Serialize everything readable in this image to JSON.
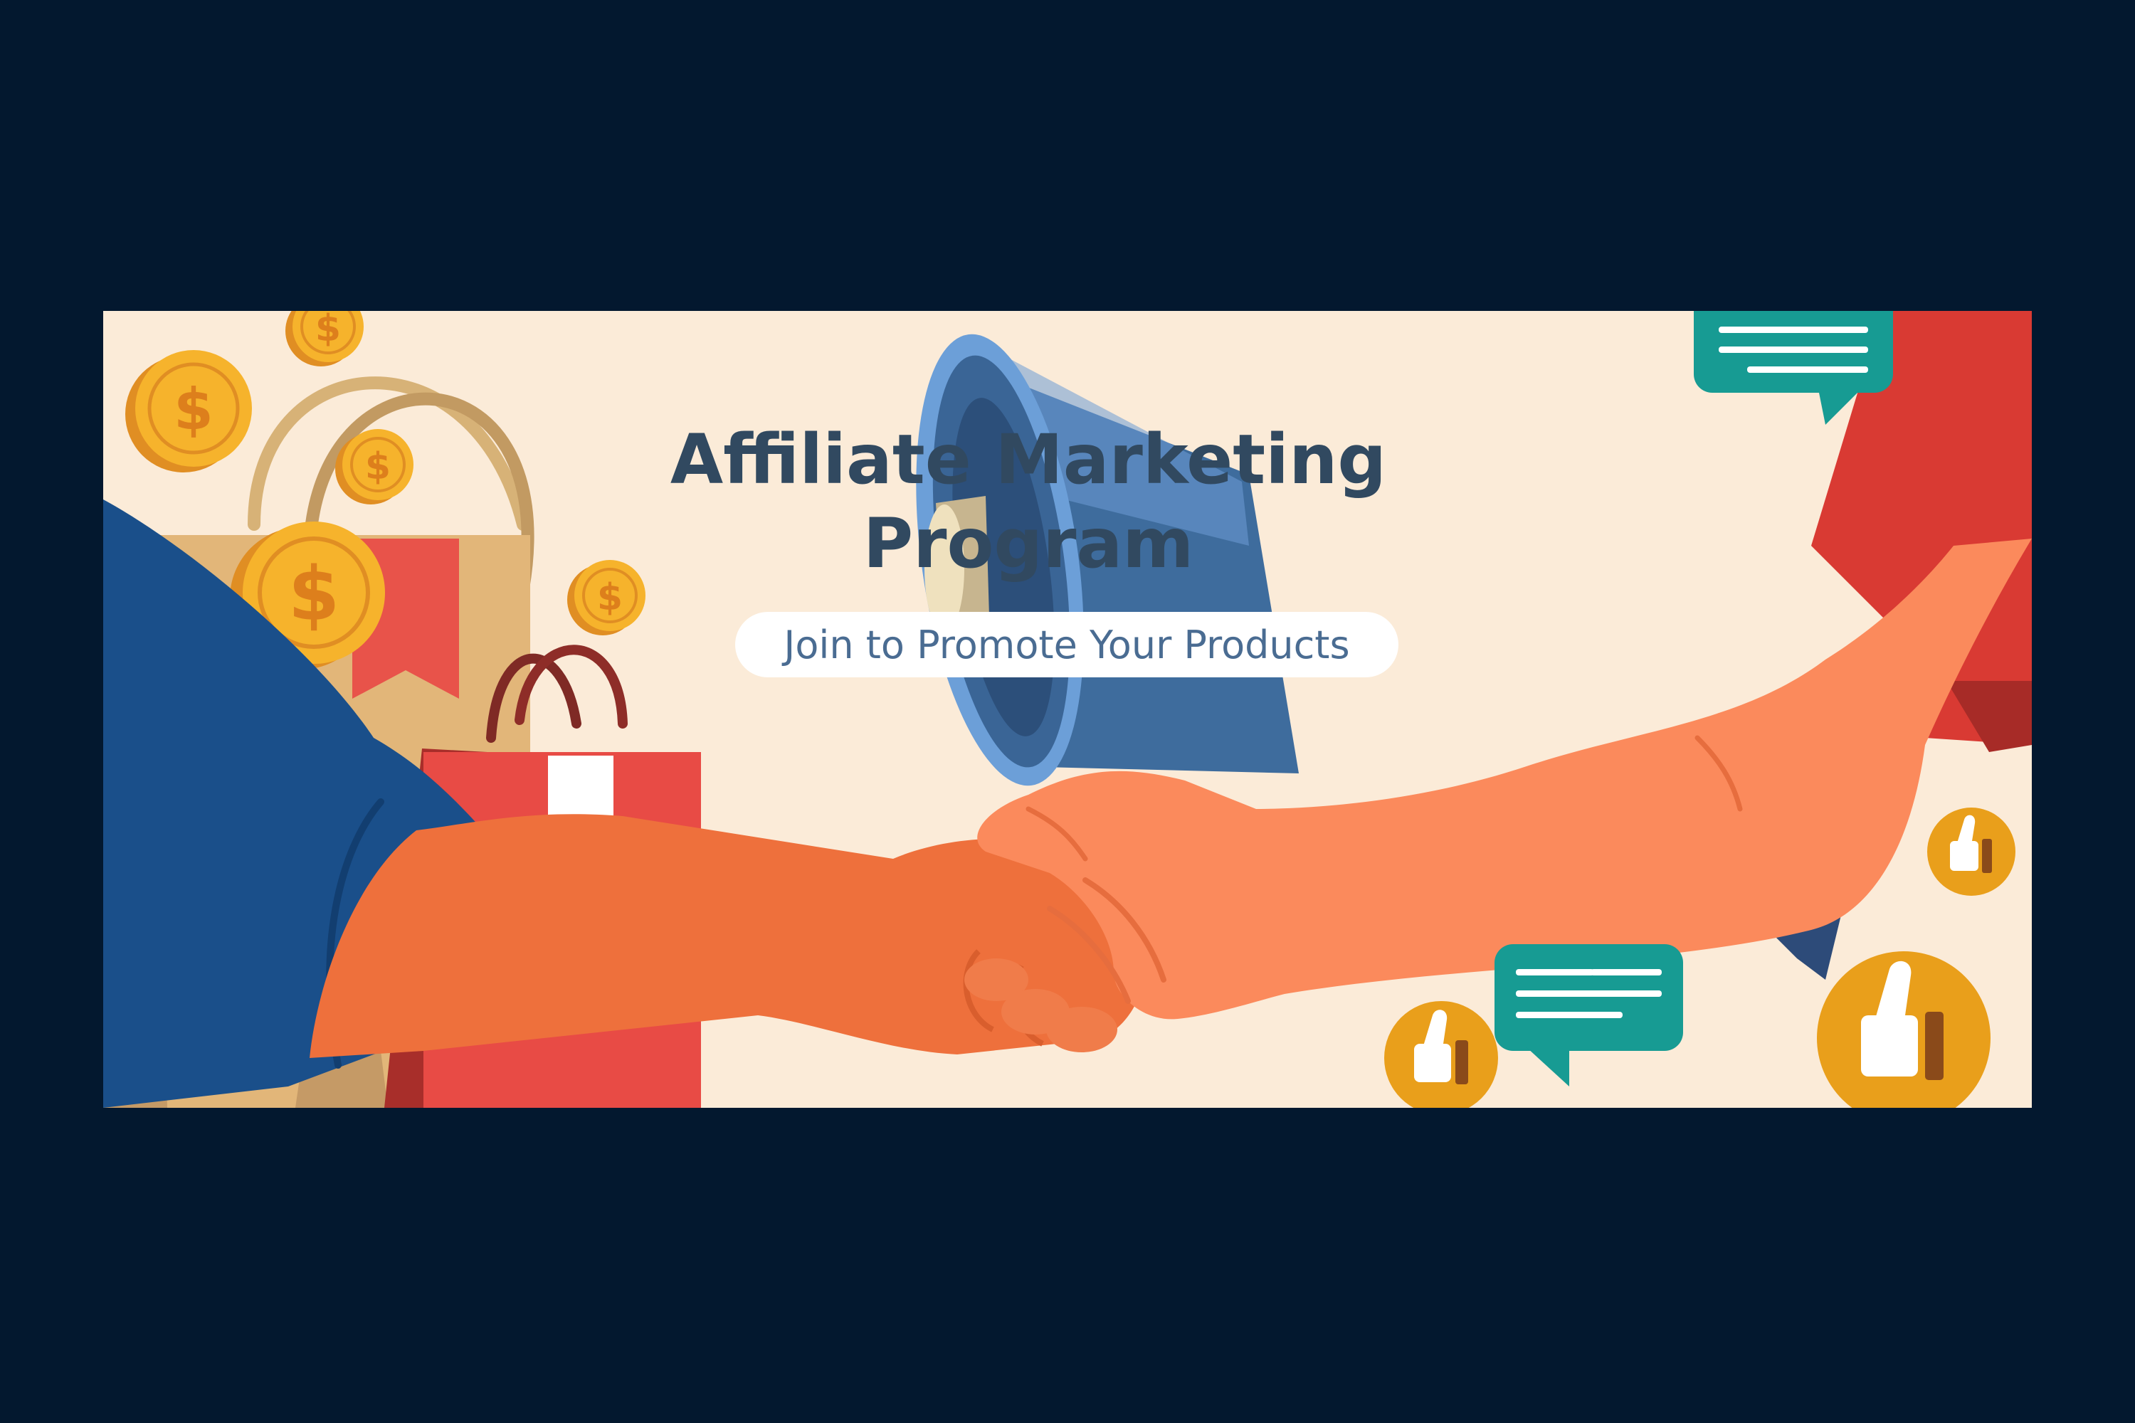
{
  "banner": {
    "title_line1": "Affiliate Marketing",
    "title_line2": "Program",
    "subtitle": "Join to Promote Your Products"
  },
  "illustration": {
    "coin_symbol": "$",
    "icons": [
      "coin-icon",
      "shopping-bag-icon",
      "handshake-icon",
      "megaphone-icon",
      "speech-bubble-icon",
      "thumbs-up-icon"
    ]
  },
  "colors": {
    "page_background": "#03182f",
    "banner_background": "#fbebd8",
    "title": "#314960",
    "subtitle": "#4a6c92",
    "pill": "#ffffff",
    "coin": "#f6b32c",
    "coin_edge": "#e08e23",
    "skin_left": "#ee703c",
    "skin_right": "#fb8a5c",
    "sleeve_left": "#1a4f8a",
    "sleeve_right": "#d93a33",
    "bag_tan": "#e2b679",
    "bag_red": "#e84b45",
    "megaphone": "#3d6b9c",
    "chat_bubble": "#179b93",
    "like_badge": "#e99f1b"
  }
}
